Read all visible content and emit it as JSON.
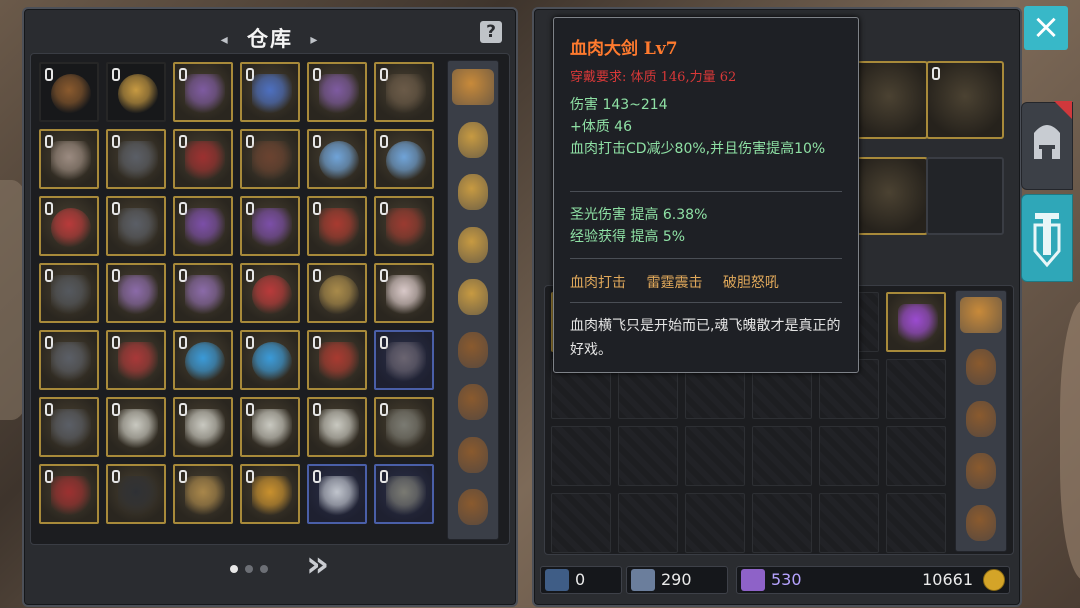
{
  "storage": {
    "title": "仓库",
    "title_deco_left": "◂",
    "title_deco_right": "▸",
    "help_icon": "?",
    "pagination": {
      "pages": 3,
      "current": 1
    },
    "next_label": "»",
    "grid": [
      [
        "pouch-brown",
        "pouch-gold",
        "bow-purple",
        "bow-blue",
        "bow-purple",
        "bow-dark"
      ],
      [
        "axe",
        "armor-dark",
        "armor-red",
        "boots",
        "ring-star-blue",
        "ring-star-blue"
      ],
      [
        "ring-red",
        "armor-dark",
        "dagger-purple",
        "dagger-purple",
        "staff-red",
        "spear-red"
      ],
      [
        "sword-dark",
        "skull-purple",
        "skull-purple",
        "ring-red",
        "ring-cross",
        "boots-white"
      ],
      [
        "helmet-dark",
        "helmet-red",
        "ring-blue",
        "ring-blue",
        "staff-red",
        "helmet-hood"
      ],
      [
        "armor-dark",
        "armor-plate",
        "armor-plate",
        "armor-plate",
        "armor-plate",
        "gauntlet"
      ],
      [
        "armor-red",
        "sword-black",
        "staff-wood",
        "amulet-red",
        "dagger-silver",
        "gauntlet"
      ]
    ],
    "side_items": [
      "chest-box",
      "pouch-gold",
      "pouch-gold",
      "pouch-gold",
      "pouch-gold",
      "pouch-brown",
      "pouch-brown",
      "pouch-brown",
      "pouch-brown"
    ]
  },
  "tooltip": {
    "name": "血肉大剑  Lv7",
    "requirement": "穿戴要求:  体质 146,力量 62",
    "stats": [
      "伤害  143~214",
      "+体质 46",
      "血肉打击CD减少80%,并且伤害提高10%"
    ],
    "bonuses": [
      "圣光伤害  提高 6.38%",
      "经验获得  提高 5%"
    ],
    "skills": [
      "血肉打击",
      "雷霆震击",
      "破胆怒吼"
    ],
    "description": "血肉横飞只是开始而已,魂飞魄散才是真正的好戏。"
  },
  "bag": {
    "side_items": [
      "chest-box",
      "pouch-brown",
      "pouch-brown",
      "pouch-brown",
      "pouch-brown"
    ],
    "row1_items": [
      "ring-gold",
      "potion-purple"
    ]
  },
  "equipment": [
    "ring-gold",
    "axe-spiked",
    "ring-gold",
    "sword-slot"
  ],
  "currency": {
    "keys": "0",
    "hearts": "290",
    "crystals": "530",
    "gold": "10661"
  },
  "close_icon": "×",
  "tabs": [
    "helmet-tab",
    "weapon-tab"
  ],
  "colors": {
    "accent": "#38b8c8",
    "gold_border": "#a88a3a",
    "blue_border": "#4a5fa8",
    "item_name": "#ff7a2e",
    "requirement": "#d83838",
    "stat": "#8ee0a4",
    "skill": "#e0a85a"
  }
}
